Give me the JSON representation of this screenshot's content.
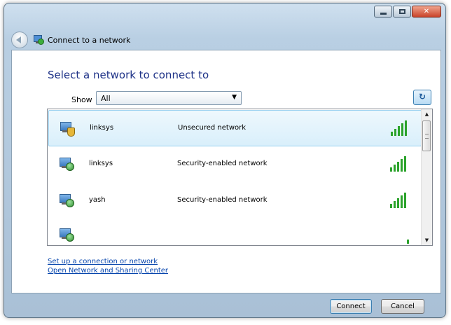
{
  "window": {
    "title": "Connect to a network",
    "caption_buttons": {
      "minimize_glyph": "",
      "maximize_glyph": "",
      "close_glyph": "✕"
    }
  },
  "main": {
    "heading": "Select a network to connect to",
    "show_label": "Show",
    "show_selected": "All",
    "refresh_glyph": "↻"
  },
  "networks": [
    {
      "name": "linksys",
      "security": "Unsecured network",
      "icon": "network-unsecured-icon",
      "signal_bars": 5,
      "selected": true
    },
    {
      "name": "linksys",
      "security": "Security-enabled network",
      "icon": "network-secured-icon",
      "signal_bars": 5,
      "selected": false
    },
    {
      "name": "yash",
      "security": "Security-enabled network",
      "icon": "network-secured-icon",
      "signal_bars": 5,
      "selected": false
    }
  ],
  "links": {
    "setup": "Set up a connection or network",
    "sharing": "Open Network and Sharing Center"
  },
  "buttons": {
    "connect": "Connect",
    "cancel": "Cancel"
  },
  "colors": {
    "heading": "#1e3287",
    "link": "#0645ad",
    "signal": "#2ca32c",
    "selection": "#d9effb"
  }
}
